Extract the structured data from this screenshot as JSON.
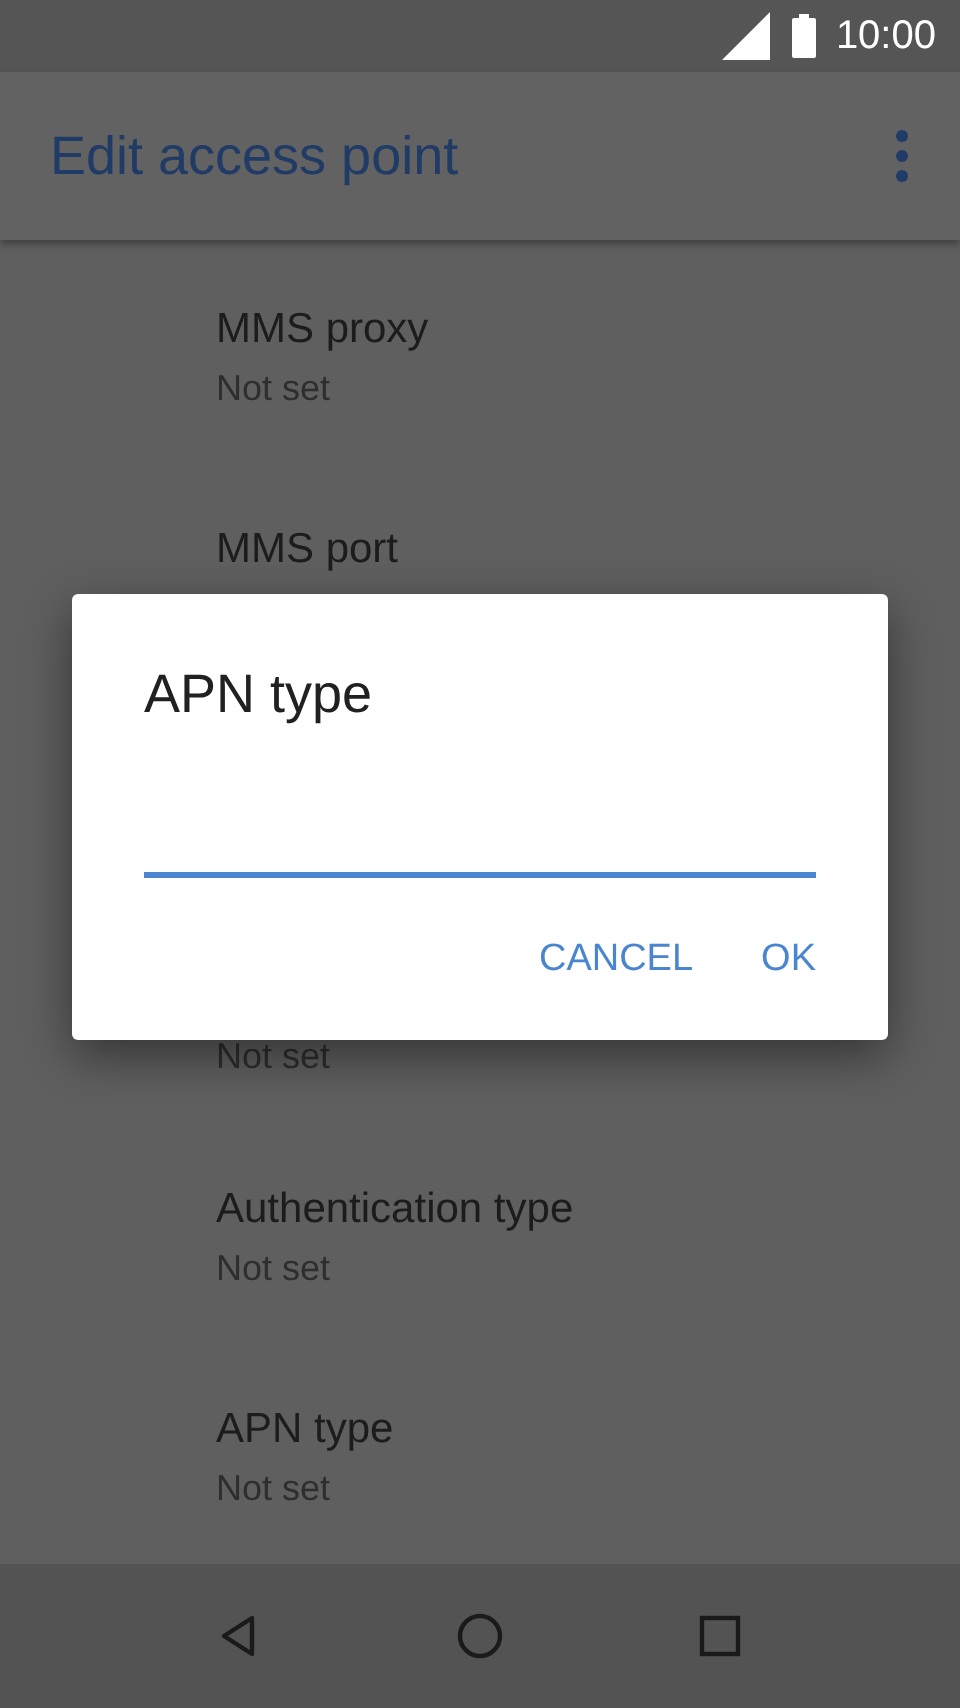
{
  "status_bar": {
    "time": "10:00"
  },
  "app_bar": {
    "title": "Edit access point"
  },
  "settings": [
    {
      "title": "MMS proxy",
      "subtitle": "Not set"
    },
    {
      "title": "MMS port"
    },
    {
      "subtitle": "Not set"
    },
    {
      "title": "Authentication type",
      "subtitle": "Not set"
    },
    {
      "title": "APN type",
      "subtitle": "Not set"
    }
  ],
  "dialog": {
    "title": "APN type",
    "input": {
      "focused": true
    },
    "buttons": [
      "CANCEL",
      "OK"
    ]
  }
}
